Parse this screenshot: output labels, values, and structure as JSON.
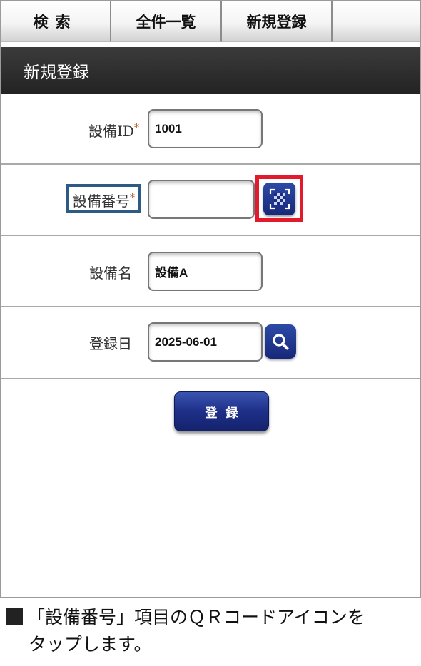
{
  "tabs": [
    {
      "label": "検索"
    },
    {
      "label": "全件一覧"
    },
    {
      "label": "新規登録"
    }
  ],
  "page_title": "新規登録",
  "form": {
    "equipment_id": {
      "label": "設備ID",
      "required_mark": "*",
      "value": "1001"
    },
    "equipment_number": {
      "label": "設備番号",
      "required_mark": "*",
      "value": "",
      "scan_icon": "qr-code-icon"
    },
    "equipment_name": {
      "label": "設備名",
      "value": "設備A"
    },
    "registration_date": {
      "label": "登録日",
      "value": "2025-06-01",
      "search_icon": "magnifier-icon"
    }
  },
  "submit_label": "登録",
  "highlight_colors": {
    "label_box": "#2e5b86",
    "icon_box": "#e21a2b"
  },
  "caption": {
    "line1": "「設備番号」項目のＱＲコードアイコンを",
    "line2": "タップします。"
  }
}
